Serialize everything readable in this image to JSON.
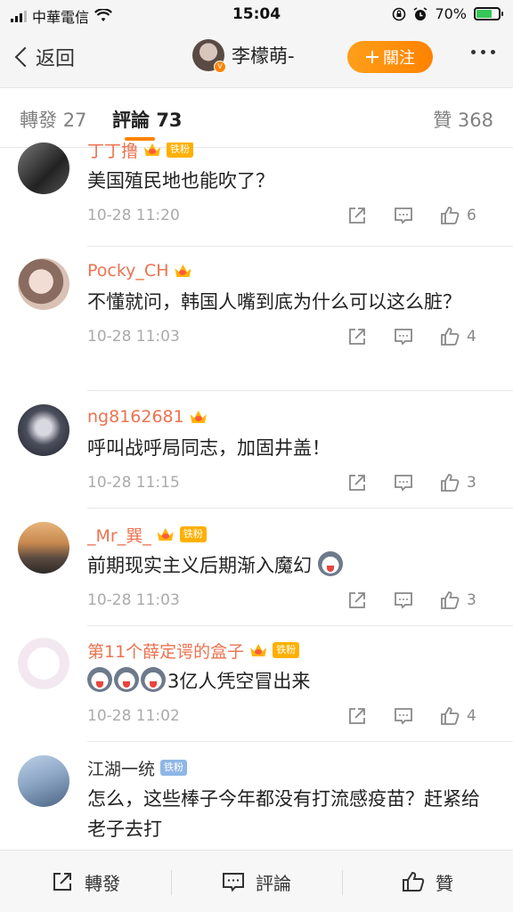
{
  "status_bar": {
    "carrier": "中華電信",
    "time": "15:04",
    "battery_percent": "70%",
    "battery_level": 0.7
  },
  "nav": {
    "back_label": "返回",
    "user_name": "李檬萌-",
    "follow_label": "關注"
  },
  "tabs": {
    "repost_label": "轉發",
    "repost_count": "27",
    "comment_label": "評論",
    "comment_count": "73",
    "like_label": "贊",
    "like_count": "368"
  },
  "comments": [
    {
      "name": "丁丁撸",
      "badge": "铁粉",
      "text": "美国殖民地也能吹了？",
      "time": "10-28 11:20",
      "likes": "6"
    },
    {
      "name": "Pocky_CH",
      "text": "不懂就问，韩国人嘴到底为什么可以这么脏？",
      "time": "10-28 11:03",
      "likes": "4"
    },
    {
      "name": "ng8162681",
      "text": "呼叫战呼局同志，加固井盖！",
      "time": "10-28 11:15",
      "likes": "3"
    },
    {
      "name": "_Mr_巽_",
      "badge": "铁粉",
      "text": "前期现实主义后期渐入魔幻",
      "time": "10-28 11:03",
      "likes": "3"
    },
    {
      "name": "第11个薛定谔的盒子",
      "badge": "铁粉",
      "text": "3亿人凭空冒出来",
      "time": "10-28 11:02",
      "likes": "4"
    },
    {
      "name": "江湖一统",
      "badge": "铁粉",
      "text": "怎么，这些棒子今年都没有打流感疫苗？赶紧给老子去打"
    }
  ],
  "bottom_bar": {
    "repost_label": "轉發",
    "comment_label": "評論",
    "like_label": "贊"
  },
  "colors": {
    "accent_orange": "#ff8200",
    "username_orange": "#eb7350",
    "fan_badge_gold": "#ffb000",
    "fan_badge_blue": "#8fb6e6"
  },
  "icons": [
    "wifi-icon",
    "lock-rotation-icon",
    "alarm-icon",
    "battery-icon",
    "back-chevron-icon",
    "plus-icon",
    "more-icon",
    "share-icon",
    "comment-icon",
    "like-icon",
    "crown-icon",
    "emoji-icon"
  ]
}
